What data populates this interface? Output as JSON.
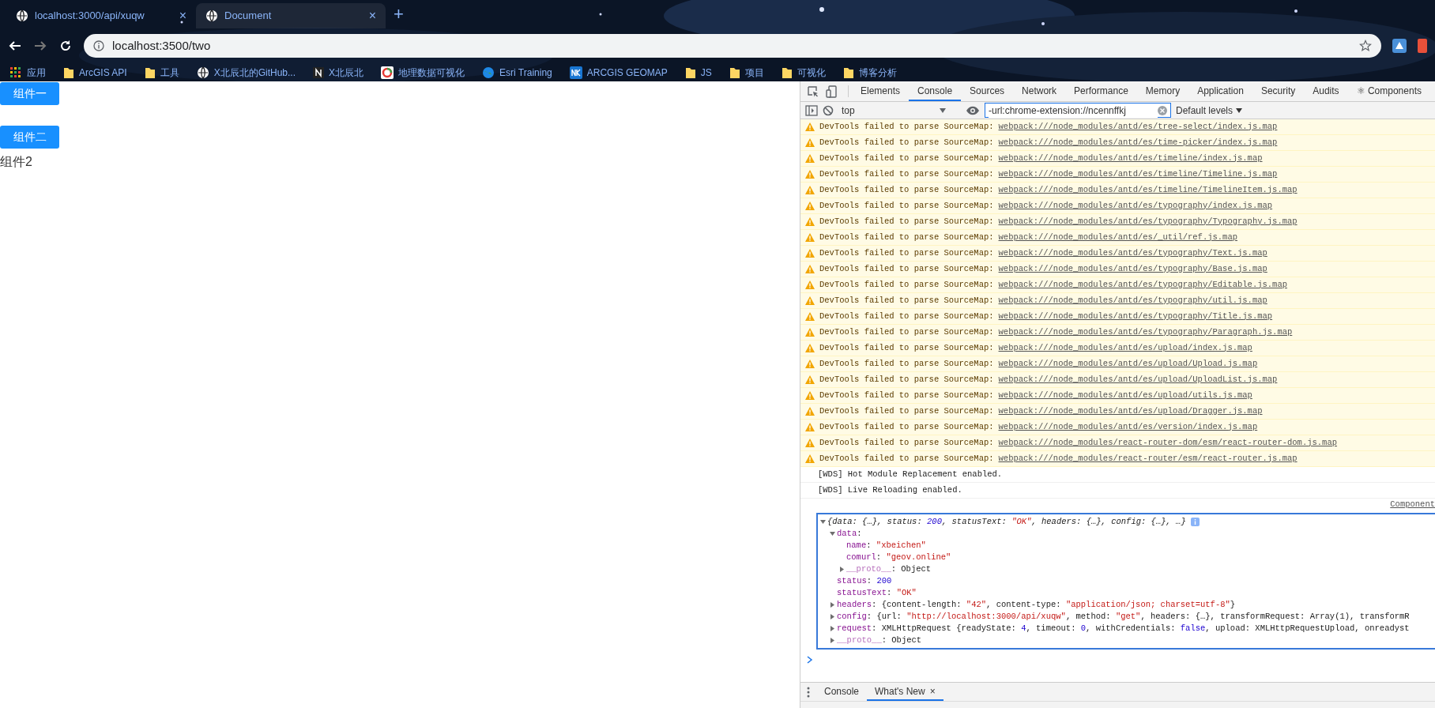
{
  "browser": {
    "tabs": [
      {
        "title": "localhost:3000/api/xuqw",
        "selected": false,
        "close": "×"
      },
      {
        "title": "Document",
        "selected": true,
        "close": "×"
      }
    ],
    "new_tab": "+",
    "address": "localhost:3500/two",
    "bookmarks": [
      {
        "label": "应用",
        "kind": "apps"
      },
      {
        "label": "ArcGIS API",
        "kind": "folder"
      },
      {
        "label": "工具",
        "kind": "folder"
      },
      {
        "label": "X北辰北的GitHub...",
        "kind": "site"
      },
      {
        "label": "X北辰北",
        "kind": "letter"
      },
      {
        "label": "地理数据可视化",
        "kind": "chart"
      },
      {
        "label": "Esri Training",
        "kind": "earth"
      },
      {
        "label": "ARCGIS GEOMAP",
        "kind": "badge"
      },
      {
        "label": "JS",
        "kind": "folder"
      },
      {
        "label": "项目",
        "kind": "folder"
      },
      {
        "label": "可视化",
        "kind": "folder"
      },
      {
        "label": "博客分析",
        "kind": "folder"
      }
    ]
  },
  "page": {
    "buttons": [
      "组件一",
      "组件二"
    ],
    "text": "组件2"
  },
  "devtools": {
    "panels": [
      {
        "label": "Elements",
        "selected": false
      },
      {
        "label": "Console",
        "selected": true
      },
      {
        "label": "Sources",
        "selected": false
      },
      {
        "label": "Network",
        "selected": false
      },
      {
        "label": "Performance",
        "selected": false
      },
      {
        "label": "Memory",
        "selected": false
      },
      {
        "label": "Application",
        "selected": false
      },
      {
        "label": "Security",
        "selected": false
      },
      {
        "label": "Audits",
        "selected": false
      },
      {
        "label": "⚛ Components",
        "selected": false
      }
    ],
    "context": "top",
    "filter": "-url:chrome-extension://ncennffkj",
    "levels": "Default levels",
    "messages": [
      {
        "kind": "warning",
        "text": "DevTools failed to parse SourceMap:",
        "link": "webpack:///node_modules/antd/es/tree-select/index.js.map"
      },
      {
        "kind": "warning",
        "text": "DevTools failed to parse SourceMap:",
        "link": "webpack:///node_modules/antd/es/time-picker/index.js.map"
      },
      {
        "kind": "warning",
        "text": "DevTools failed to parse SourceMap:",
        "link": "webpack:///node_modules/antd/es/timeline/index.js.map"
      },
      {
        "kind": "warning",
        "text": "DevTools failed to parse SourceMap:",
        "link": "webpack:///node_modules/antd/es/timeline/Timeline.js.map"
      },
      {
        "kind": "warning",
        "text": "DevTools failed to parse SourceMap:",
        "link": "webpack:///node_modules/antd/es/timeline/TimelineItem.js.map"
      },
      {
        "kind": "warning",
        "text": "DevTools failed to parse SourceMap:",
        "link": "webpack:///node_modules/antd/es/typography/index.js.map"
      },
      {
        "kind": "warning",
        "text": "DevTools failed to parse SourceMap:",
        "link": "webpack:///node_modules/antd/es/typography/Typography.js.map"
      },
      {
        "kind": "warning",
        "text": "DevTools failed to parse SourceMap:",
        "link": "webpack:///node_modules/antd/es/_util/ref.js.map"
      },
      {
        "kind": "warning",
        "text": "DevTools failed to parse SourceMap:",
        "link": "webpack:///node_modules/antd/es/typography/Text.js.map"
      },
      {
        "kind": "warning",
        "text": "DevTools failed to parse SourceMap:",
        "link": "webpack:///node_modules/antd/es/typography/Base.js.map"
      },
      {
        "kind": "warning",
        "text": "DevTools failed to parse SourceMap:",
        "link": "webpack:///node_modules/antd/es/typography/Editable.js.map"
      },
      {
        "kind": "warning",
        "text": "DevTools failed to parse SourceMap:",
        "link": "webpack:///node_modules/antd/es/typography/util.js.map"
      },
      {
        "kind": "warning",
        "text": "DevTools failed to parse SourceMap:",
        "link": "webpack:///node_modules/antd/es/typography/Title.js.map"
      },
      {
        "kind": "warning",
        "text": "DevTools failed to parse SourceMap:",
        "link": "webpack:///node_modules/antd/es/typography/Paragraph.js.map"
      },
      {
        "kind": "warning",
        "text": "DevTools failed to parse SourceMap:",
        "link": "webpack:///node_modules/antd/es/upload/index.js.map"
      },
      {
        "kind": "warning",
        "text": "DevTools failed to parse SourceMap:",
        "link": "webpack:///node_modules/antd/es/upload/Upload.js.map"
      },
      {
        "kind": "warning",
        "text": "DevTools failed to parse SourceMap:",
        "link": "webpack:///node_modules/antd/es/upload/UploadList.js.map"
      },
      {
        "kind": "warning",
        "text": "DevTools failed to parse SourceMap:",
        "link": "webpack:///node_modules/antd/es/upload/utils.js.map"
      },
      {
        "kind": "warning",
        "text": "DevTools failed to parse SourceMap:",
        "link": "webpack:///node_modules/antd/es/upload/Dragger.js.map"
      },
      {
        "kind": "warning",
        "text": "DevTools failed to parse SourceMap:",
        "link": "webpack:///node_modules/antd/es/version/index.js.map"
      },
      {
        "kind": "warning",
        "text": "DevTools failed to parse SourceMap:",
        "link": "webpack:///node_modules/react-router-dom/esm/react-router-dom.js.map"
      },
      {
        "kind": "warning",
        "text": "DevTools failed to parse SourceMap:",
        "link": "webpack:///node_modules/react-router/esm/react-router.js.map"
      },
      {
        "kind": "log",
        "text": "[WDS] Hot Module Replacement enabled."
      },
      {
        "kind": "log",
        "text": "[WDS] Live Reloading enabled."
      }
    ],
    "source_link": "Component",
    "object": {
      "expanded": true,
      "parts": [
        {
          "kind": "plain",
          "text": "{data: {…}, status: "
        },
        {
          "kind": "number",
          "text": "200"
        },
        {
          "kind": "plain",
          "text": ", statusText: "
        },
        {
          "kind": "string",
          "text": "\"OK\""
        },
        {
          "kind": "plain",
          "text": ", headers: {…}, config: {…}, …}"
        }
      ],
      "children": [
        {
          "expanded": true,
          "parts": [
            {
              "kind": "key",
              "text": "data"
            },
            {
              "kind": "plain",
              "text": ":"
            }
          ],
          "children": [
            {
              "parts": [
                {
                  "kind": "key",
                  "text": "name"
                },
                {
                  "kind": "plain",
                  "text": ": "
                },
                {
                  "kind": "string",
                  "text": "\"xbeichen\""
                }
              ]
            },
            {
              "parts": [
                {
                  "kind": "key",
                  "text": "comurl"
                },
                {
                  "kind": "plain",
                  "text": ": "
                },
                {
                  "kind": "string",
                  "text": "\"geov.online\""
                }
              ]
            },
            {
              "expanded": false,
              "parts": [
                {
                  "kind": "internal",
                  "text": "__proto__"
                },
                {
                  "kind": "plain",
                  "text": ": Object"
                }
              ]
            }
          ]
        },
        {
          "parts": [
            {
              "kind": "key",
              "text": "status"
            },
            {
              "kind": "plain",
              "text": ": "
            },
            {
              "kind": "number",
              "text": "200"
            }
          ]
        },
        {
          "parts": [
            {
              "kind": "key",
              "text": "statusText"
            },
            {
              "kind": "plain",
              "text": ": "
            },
            {
              "kind": "string",
              "text": "\"OK\""
            }
          ]
        },
        {
          "expanded": false,
          "parts": [
            {
              "kind": "key",
              "text": "headers"
            },
            {
              "kind": "plain",
              "text": ": {content-length: "
            },
            {
              "kind": "string",
              "text": "\"42\""
            },
            {
              "kind": "plain",
              "text": ", content-type: "
            },
            {
              "kind": "string",
              "text": "\"application/json; charset=utf-8\""
            },
            {
              "kind": "plain",
              "text": "}"
            }
          ]
        },
        {
          "expanded": false,
          "parts": [
            {
              "kind": "key",
              "text": "config"
            },
            {
              "kind": "plain",
              "text": ": {url: "
            },
            {
              "kind": "string",
              "text": "\"http://localhost:3000/api/xuqw\""
            },
            {
              "kind": "plain",
              "text": ", method: "
            },
            {
              "kind": "string",
              "text": "\"get\""
            },
            {
              "kind": "plain",
              "text": ", headers: {…}, transformRequest: Array(1), transformR"
            }
          ]
        },
        {
          "expanded": false,
          "parts": [
            {
              "kind": "key",
              "text": "request"
            },
            {
              "kind": "plain",
              "text": ": XMLHttpRequest {readyState: "
            },
            {
              "kind": "number",
              "text": "4"
            },
            {
              "kind": "plain",
              "text": ", timeout: "
            },
            {
              "kind": "number",
              "text": "0"
            },
            {
              "kind": "plain",
              "text": ", withCredentials: "
            },
            {
              "kind": "number",
              "text": "false"
            },
            {
              "kind": "plain",
              "text": ", upload: XMLHttpRequestUpload, onreadyst"
            }
          ]
        },
        {
          "expanded": false,
          "parts": [
            {
              "kind": "internal",
              "text": "__proto__"
            },
            {
              "kind": "plain",
              "text": ": Object"
            }
          ]
        }
      ]
    },
    "drawer": {
      "tabs": [
        {
          "label": "Console",
          "selected": false
        },
        {
          "label": "What's New",
          "selected": true,
          "close": "×"
        }
      ]
    }
  }
}
